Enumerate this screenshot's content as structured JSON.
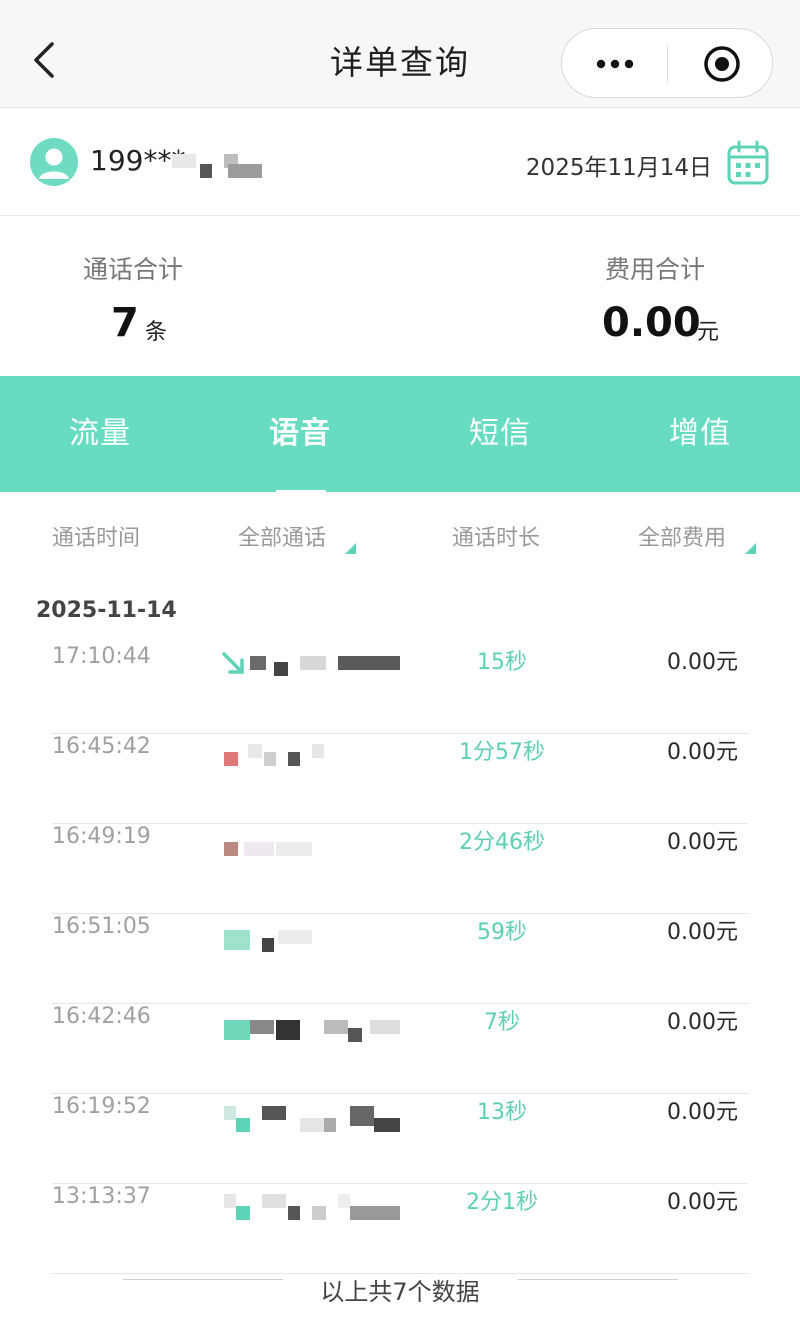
{
  "header": {
    "title": "详单查询",
    "back_icon": "chevron-left-icon",
    "more_icon": "more-dots-icon",
    "close_icon": "target-circle-icon"
  },
  "user": {
    "phone_masked": "199***",
    "date": "2025年11月14日",
    "avatar_icon": "user-avatar-icon",
    "calendar_icon": "calendar-icon"
  },
  "summary": {
    "calls_label": "通话合计",
    "calls_value": "7",
    "calls_unit": "条",
    "fee_label": "费用合计",
    "fee_value": "0.00",
    "fee_unit": "元"
  },
  "tabs": [
    {
      "label": "流量",
      "active": false
    },
    {
      "label": "语音",
      "active": true
    },
    {
      "label": "短信",
      "active": false
    },
    {
      "label": "增值",
      "active": false
    }
  ],
  "columns": {
    "time": "通话时间",
    "type": "全部通话",
    "duration": "通话时长",
    "fee": "全部费用"
  },
  "group_date": "2025-11-14",
  "rows": [
    {
      "time": "17:10:44",
      "duration": "15秒",
      "fee": "0.00元"
    },
    {
      "time": "16:45:42",
      "duration": "1分57秒",
      "fee": "0.00元"
    },
    {
      "time": "16:49:19",
      "duration": "2分46秒",
      "fee": "0.00元"
    },
    {
      "time": "16:51:05",
      "duration": "59秒",
      "fee": "0.00元"
    },
    {
      "time": "16:42:46",
      "duration": "7秒",
      "fee": "0.00元"
    },
    {
      "time": "16:19:52",
      "duration": "13秒",
      "fee": "0.00元"
    },
    {
      "time": "13:13:37",
      "duration": "2分1秒",
      "fee": "0.00元"
    }
  ],
  "footer": "以上共7个数据",
  "colors": {
    "accent": "#67dcc1",
    "duration_text": "#5ccfb4"
  }
}
